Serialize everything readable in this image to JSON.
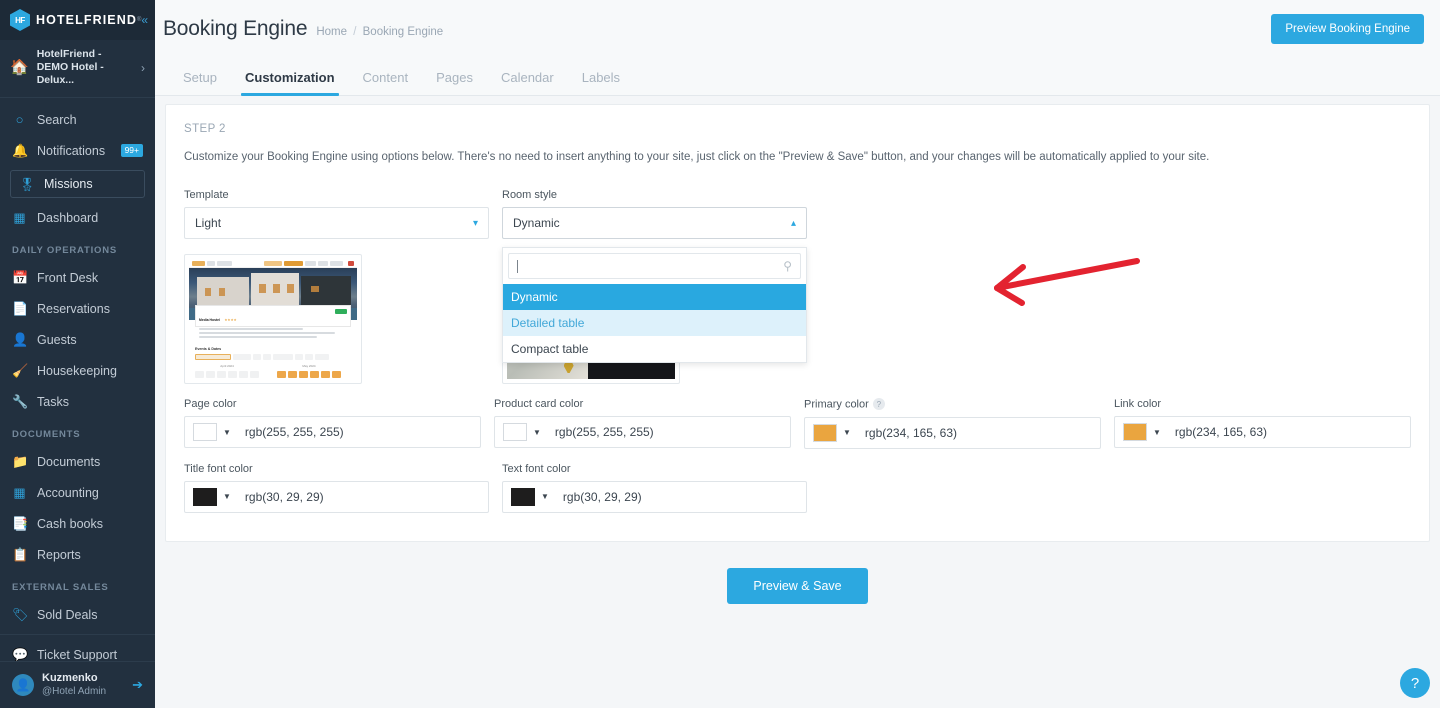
{
  "sidebar": {
    "logo": {
      "text": "HOTELFRIEND",
      "registered": "®",
      "collapse_icon": "chevrons-left-icon"
    },
    "hotel": {
      "name": "HotelFriend - DEMO Hotel - Delux...",
      "icon": "home-icon",
      "arrow": "›"
    },
    "quick_items": [
      {
        "label": "Search",
        "icon": "search-icon",
        "badge": ""
      },
      {
        "label": "Notifications",
        "icon": "bell-icon",
        "badge": "99+"
      }
    ],
    "missions": {
      "label": "Missions",
      "icon": "award-icon"
    },
    "dashboard": {
      "label": "Dashboard",
      "icon": "grid-icon"
    },
    "groups": [
      {
        "title": "DAILY OPERATIONS",
        "items": [
          {
            "label": "Front Desk",
            "icon": "calendar-icon"
          },
          {
            "label": "Reservations",
            "icon": "file-icon"
          },
          {
            "label": "Guests",
            "icon": "user-icon"
          },
          {
            "label": "Housekeeping",
            "icon": "cleaning-icon"
          },
          {
            "label": "Tasks",
            "icon": "wrench-icon"
          }
        ]
      },
      {
        "title": "DOCUMENTS",
        "items": [
          {
            "label": "Documents",
            "icon": "folder-icon"
          },
          {
            "label": "Accounting",
            "icon": "calculator-icon"
          },
          {
            "label": "Cash books",
            "icon": "book-icon"
          },
          {
            "label": "Reports",
            "icon": "clipboard-icon"
          }
        ]
      },
      {
        "title": "EXTERNAL SALES",
        "items": [
          {
            "label": "Sold Deals",
            "icon": "tag-icon"
          }
        ]
      }
    ],
    "support": {
      "label": "Ticket Support",
      "icon": "chat-icon"
    },
    "user": {
      "name": "Kuzmenko",
      "role": "@Hotel Admin",
      "avatar_icon": "user-avatar-icon",
      "logout_icon": "logout-icon"
    }
  },
  "header": {
    "title": "Booking Engine",
    "breadcrumb": {
      "home": "Home",
      "separator": "/",
      "current": "Booking Engine"
    },
    "preview_button": "Preview Booking Engine"
  },
  "tabs": [
    {
      "label": "Setup",
      "active": false
    },
    {
      "label": "Customization",
      "active": true
    },
    {
      "label": "Content",
      "active": false
    },
    {
      "label": "Pages",
      "active": false
    },
    {
      "label": "Calendar",
      "active": false
    },
    {
      "label": "Labels",
      "active": false
    }
  ],
  "content": {
    "step": "STEP 2",
    "intro": "Customize your Booking Engine using options below. There's no need to insert anything to your site, just click on the \"Preview & Save\" button, and your changes will be automatically applied to your site.",
    "template_field": {
      "label": "Template",
      "value": "Light",
      "chevron_icon": "chevron-down-icon"
    },
    "room_style_field": {
      "label": "Room style",
      "value": "Dynamic",
      "chevron_icon": "chevron-up-icon",
      "search_placeholder": "",
      "search_value": "",
      "search_icon": "search-icon",
      "options": [
        {
          "label": "Dynamic",
          "state": "selected"
        },
        {
          "label": "Detailed table",
          "state": "highlighted"
        },
        {
          "label": "Compact table",
          "state": "normal"
        }
      ]
    },
    "colors": [
      {
        "label": "Page color",
        "value": "rgb(255, 255, 255)",
        "swatch": "#ffffff",
        "help": false
      },
      {
        "label": "Product card color",
        "value": "rgb(255, 255, 255)",
        "swatch": "#ffffff",
        "help": false
      },
      {
        "label": "Primary color",
        "value": "rgb(234, 165, 63)",
        "swatch": "#eaa53f",
        "help": true,
        "help_glyph": "?"
      },
      {
        "label": "Link color",
        "value": "rgb(234, 165, 63)",
        "swatch": "#eaa53f",
        "help": false
      },
      {
        "label": "Title font color",
        "value": "rgb(30, 29, 29)",
        "swatch": "#1e1d1d",
        "help": false
      },
      {
        "label": "Text font color",
        "value": "rgb(30, 29, 29)",
        "swatch": "#1e1d1d",
        "help": false
      }
    ],
    "save_button": "Preview & Save"
  },
  "annotation": {
    "type": "red-arrow",
    "direction": "left",
    "color": "#e32330"
  },
  "help_fab": {
    "glyph": "?",
    "icon": "help-icon"
  },
  "theme": {
    "accent": "#2ca8e0",
    "sidebar_bg": "#22303f",
    "page_bg": "#f4f6f8",
    "option_selected_bg": "#29a8e0",
    "option_highlight_bg": "#ddf1fb"
  }
}
